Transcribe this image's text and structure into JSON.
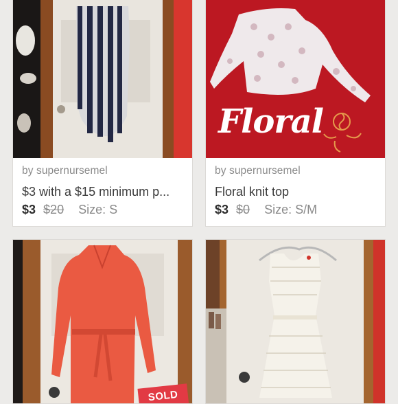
{
  "listings": [
    {
      "seller": "by supernursemel",
      "title": "$3 with a $15 minimum p...",
      "price": "$3",
      "original_price": "$20",
      "size": "Size: S"
    },
    {
      "seller": "by supernursemel",
      "title": "Floral knit top",
      "price": "$3",
      "original_price": "$0",
      "size": "Size: S/M",
      "photo_overlay_text": "Floral"
    },
    {
      "badge": "SOLD"
    },
    {}
  ],
  "colors": {
    "background": "#ecebe9",
    "sold_badge": "#e23a44",
    "price_text": "#2e2e2e",
    "muted_text": "#8a8a8a"
  }
}
